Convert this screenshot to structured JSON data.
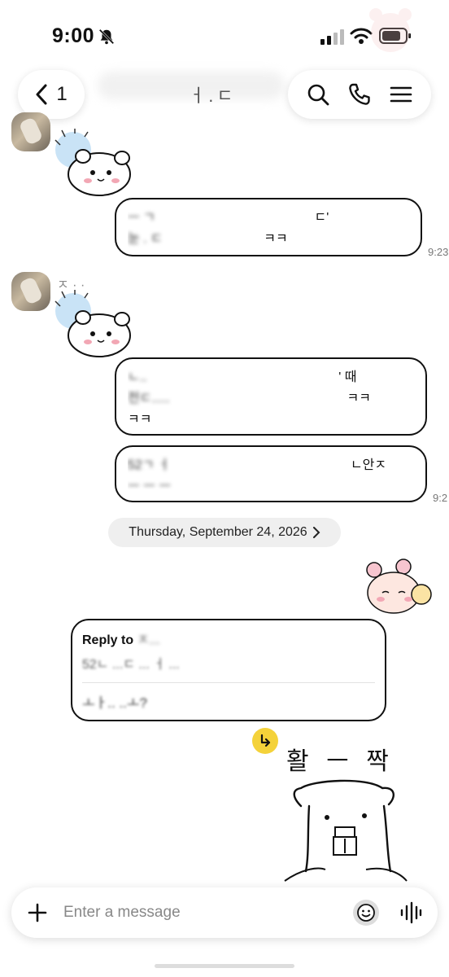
{
  "status": {
    "time": "9:00"
  },
  "header": {
    "back_count": "1",
    "title": "ㅓ.ㄷ"
  },
  "messages": [
    {
      "sender_name": "",
      "bubble_lines": [
        {
          "blurred": "ㅡ ㄱ",
          "tail": "ㄷ'"
        },
        {
          "blurred": "눈 . ㄷ",
          "tail": "ㅋㅋ"
        }
      ],
      "time": "9:23"
    },
    {
      "sender_name": "ㅈ ·   ·",
      "bubble1_lines": [
        {
          "blurred": "ㄴ..",
          "tail": "' 때"
        },
        {
          "blurred": "전ㄷ.....",
          "tail": "ㅋㅋ"
        },
        {
          "blurred": "",
          "tail": "ㅋㅋ"
        }
      ],
      "bubble2_lines": [
        {
          "blurred": "52ㄱ ㅓ",
          "tail": "ㄴ안ㅈ"
        },
        {
          "blurred": "ㅡ  ㅡ ㅡ",
          "tail": ""
        }
      ],
      "time": "9:2"
    }
  ],
  "date_separator": "Thursday, September 24, 2026",
  "reply": {
    "title": "Reply to",
    "name": "ㅈ...",
    "quote": "52ㄴ ...ㄷ ... ㅓ ...",
    "text": "ㅗㅏ.. ..ㅗ?"
  },
  "emoticon": {
    "text": "활 ㅡ 짝"
  },
  "input": {
    "placeholder": "Enter a message"
  },
  "colors": {
    "accent_yellow": "#f4d23a",
    "bubble_border": "#111111"
  }
}
